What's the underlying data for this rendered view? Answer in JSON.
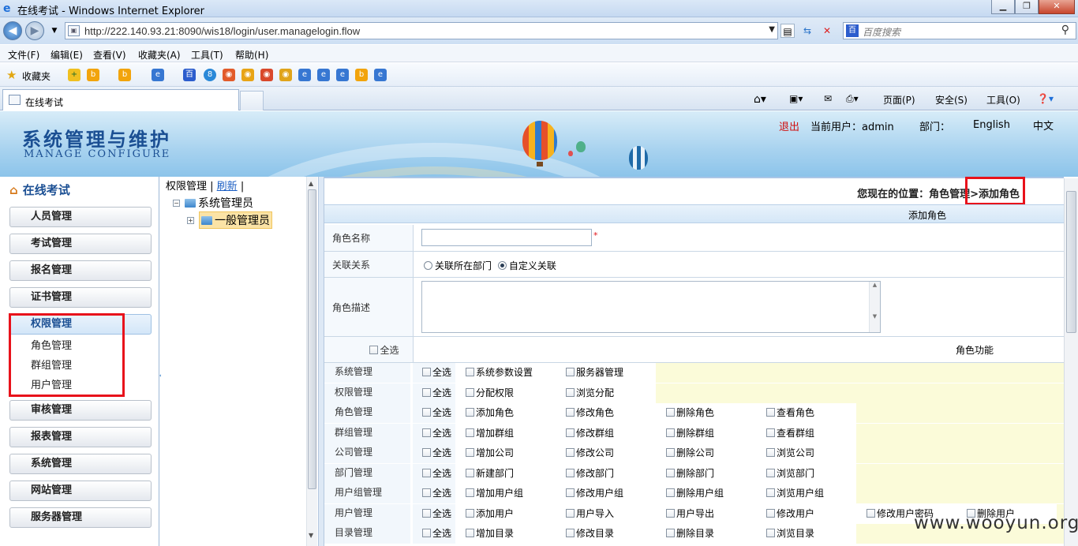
{
  "browser": {
    "window_title": "在线考试 - Windows Internet Explorer",
    "url": "http://222.140.93.21:8090/wis18/login/user.managelogin.flow",
    "search_placeholder": "百度搜索",
    "menu": [
      "文件(F)",
      "编辑(E)",
      "查看(V)",
      "收藏夹(A)",
      "工具(T)",
      "帮助(H)"
    ],
    "favorites_label": "收藏夹",
    "tab_label": "在线考试",
    "commands": [
      "页面(P)",
      "安全(S)",
      "工具(O)"
    ]
  },
  "header": {
    "title": "系统管理与维护",
    "subtitle": "MANAGE CONFIGURE",
    "logout": "退出",
    "current_user": "当前用户：admin",
    "department": "部门：",
    "lang_en": "English",
    "lang_zh": "中文"
  },
  "sidebar": {
    "title": "在线考试",
    "items": [
      {
        "label": "人员管理"
      },
      {
        "label": "考试管理"
      },
      {
        "label": "报名管理"
      },
      {
        "label": "证书管理"
      },
      {
        "label": "权限管理"
      },
      {
        "label": "审核管理"
      },
      {
        "label": "报表管理"
      },
      {
        "label": "系统管理"
      },
      {
        "label": "网站管理"
      },
      {
        "label": "服务器管理"
      }
    ],
    "sub_items": [
      "角色管理",
      "群组管理",
      "用户管理"
    ]
  },
  "tree": {
    "link_main": "权限管理",
    "link_refresh": "刷新",
    "root": "系统管理员",
    "child": "一般管理员"
  },
  "main": {
    "breadcrumb": "您现在的位置：角色管理>",
    "breadcrumb_current": "添加角色",
    "section_title": "添加角色",
    "role_name_label": "角色名称",
    "relation_label": "关联关系",
    "relation_options": [
      "关联所在部门",
      "自定义关联"
    ],
    "relation_selected": "自定义关联",
    "desc_label": "角色描述",
    "select_all": "全选",
    "function_header": "角色功能",
    "permissions": [
      {
        "module": "系统管理",
        "actions": [
          "系统参数设置",
          "服务器管理"
        ]
      },
      {
        "module": "权限管理",
        "actions": [
          "分配权限",
          "浏览分配"
        ]
      },
      {
        "module": "角色管理",
        "actions": [
          "添加角色",
          "修改角色",
          "删除角色",
          "查看角色"
        ]
      },
      {
        "module": "群组管理",
        "actions": [
          "增加群组",
          "修改群组",
          "删除群组",
          "查看群组"
        ]
      },
      {
        "module": "公司管理",
        "actions": [
          "增加公司",
          "修改公司",
          "删除公司",
          "浏览公司"
        ]
      },
      {
        "module": "部门管理",
        "actions": [
          "新建部门",
          "修改部门",
          "删除部门",
          "浏览部门"
        ]
      },
      {
        "module": "用户组管理",
        "actions": [
          "增加用户组",
          "修改用户组",
          "删除用户组",
          "浏览用户组"
        ]
      },
      {
        "module": "用户管理",
        "actions": [
          "添加用户",
          "用户导入",
          "用户导出",
          "修改用户",
          "修改用户密码",
          "删除用户"
        ]
      },
      {
        "module": "目录管理",
        "actions": [
          "增加目录",
          "修改目录",
          "删除目录",
          "浏览目录"
        ]
      }
    ]
  },
  "watermark": "www.wooyun.org"
}
